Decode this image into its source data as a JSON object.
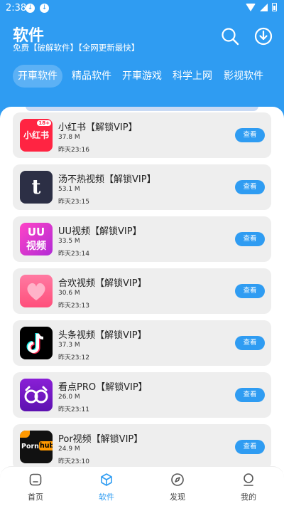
{
  "status_bar": {
    "time": "2:38"
  },
  "header": {
    "title": "软件",
    "subtitle": "免费【破解软件】【全网更新最快】"
  },
  "tabs": [
    {
      "label": "开車软件",
      "active": true
    },
    {
      "label": "精品软件",
      "active": false
    },
    {
      "label": "开車游戏",
      "active": false
    },
    {
      "label": "科学上网",
      "active": false
    },
    {
      "label": "影视软件",
      "active": false
    }
  ],
  "apps": [
    {
      "name": "小红书【解锁VIP】",
      "size": "37.8 M",
      "time": "昨天23:16",
      "button": "查看",
      "icon_text": "小红书",
      "icon_badge": "18+",
      "icon_color": "#ff2442"
    },
    {
      "name": "汤不热视频【解锁VIP】",
      "size": "53.1 M",
      "time": "昨天23:15",
      "button": "查看",
      "icon_text": "t",
      "icon_color": "#2c2f45"
    },
    {
      "name": "UU视频【解锁VIP】",
      "size": "33.5 M",
      "time": "昨天23:14",
      "button": "查看",
      "icon_text": "UU视频",
      "icon_color": "#e52bb5"
    },
    {
      "name": "合欢视频【解锁VIP】",
      "size": "30.6 M",
      "time": "昨天23:13",
      "button": "查看",
      "icon_text": "",
      "icon_color": "#f25b8e"
    },
    {
      "name": "头条视频【解锁VIP】",
      "size": "37.3 M",
      "time": "昨天23:12",
      "button": "查看",
      "icon_text": "",
      "icon_color": "#000000"
    },
    {
      "name": "看点PRO【解锁VIP】",
      "size": "26.0 M",
      "time": "昨天23:11",
      "button": "查看",
      "icon_text": "",
      "icon_color": "#7b18c4"
    },
    {
      "name": "Por视频【解锁VIP】",
      "size": "24.9 M",
      "time": "昨天23:10",
      "button": "查看",
      "icon_text": "Porn",
      "icon_badge": "hub",
      "icon_color": "#111111"
    }
  ],
  "nav": [
    {
      "label": "首页",
      "active": false
    },
    {
      "label": "软件",
      "active": true
    },
    {
      "label": "发现",
      "active": false
    },
    {
      "label": "我的",
      "active": false
    }
  ],
  "colors": {
    "primary": "#2f9cf2",
    "card_bg": "#eeeeee"
  }
}
